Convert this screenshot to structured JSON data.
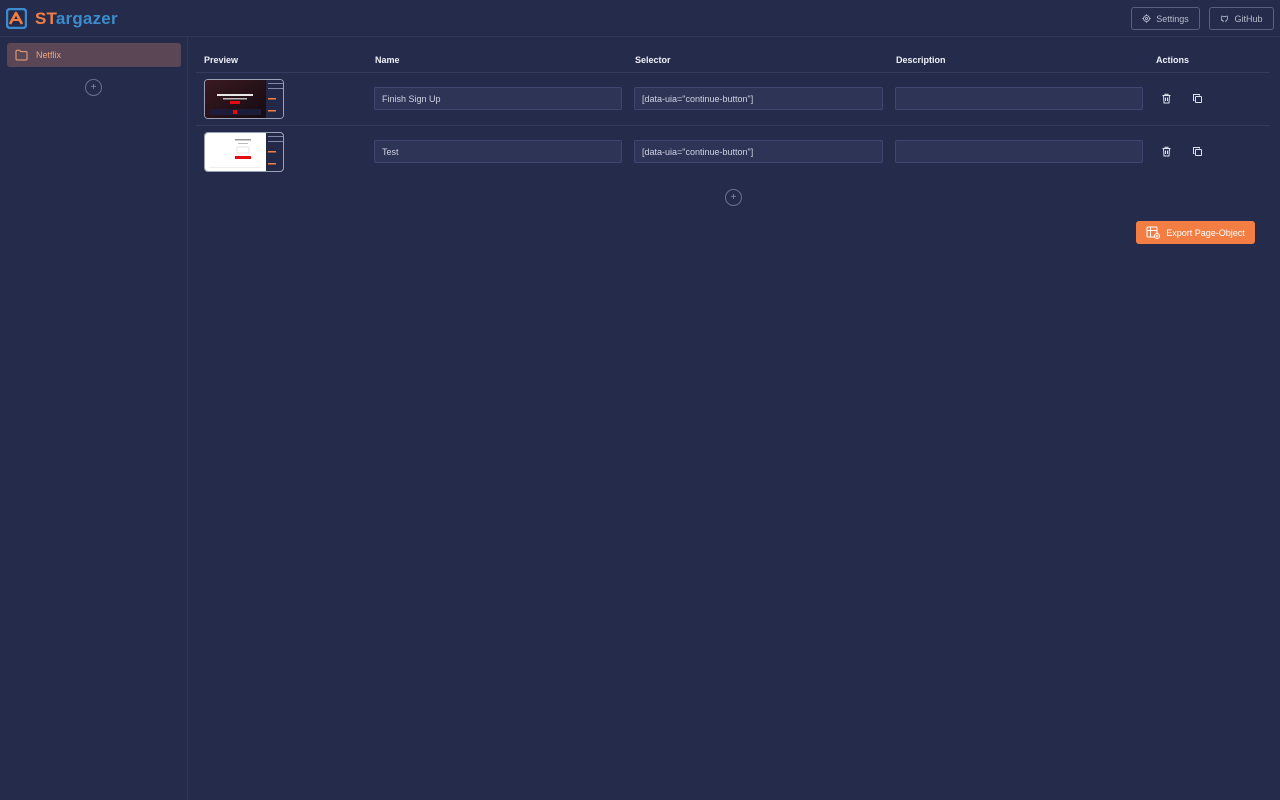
{
  "app": {
    "brand_part1": "ST",
    "brand_part2": "argazer",
    "accent_color": "#f37e44",
    "brand_blue": "#3c8ccd"
  },
  "header": {
    "settings_label": "Settings",
    "github_label": "GitHub"
  },
  "sidebar": {
    "folders": [
      {
        "label": "Netflix",
        "icon": "folder-icon",
        "selected": true
      }
    ],
    "add_icon": "+"
  },
  "table": {
    "columns": {
      "preview": "Preview",
      "name": "Name",
      "selector": "Selector",
      "description": "Description",
      "actions": "Actions"
    },
    "rows": [
      {
        "name": "Finish Sign Up",
        "selector": "[data-uia=\"continue-button\"]",
        "description": "",
        "preview_theme": "dark"
      },
      {
        "name": "Test",
        "selector": "[data-uia=\"continue-button\"]",
        "description": "",
        "preview_theme": "light"
      }
    ],
    "add_icon": "+"
  },
  "export": {
    "label": "Export Page-Object",
    "icon": "table-add-icon"
  }
}
